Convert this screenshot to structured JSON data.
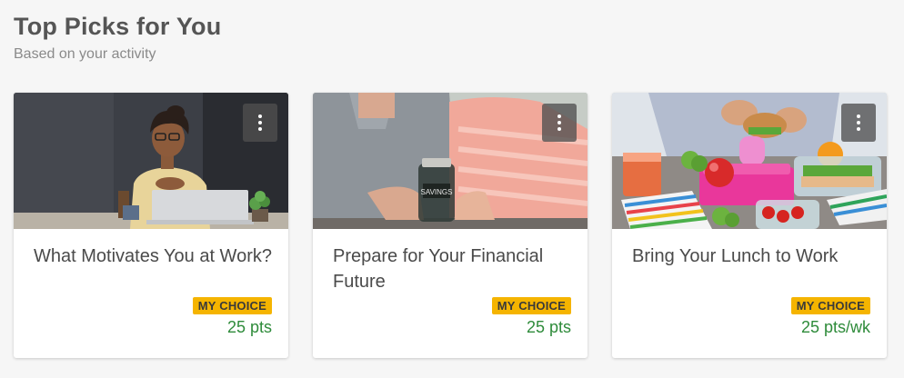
{
  "header": {
    "title": "Top Picks for You",
    "subtitle": "Based on your activity"
  },
  "cards": [
    {
      "title": "What Motivates You at Work?",
      "badge": "MY CHOICE",
      "points": "25 pts",
      "image": "woman-at-laptop",
      "jar_label": ""
    },
    {
      "title": "Prepare for Your Financial Future",
      "badge": "MY CHOICE",
      "points": "25 pts",
      "image": "couple-savings-jar",
      "jar_label": "SAVINGS"
    },
    {
      "title": "Bring Your Lunch to Work",
      "badge": "MY CHOICE",
      "points": "25 pts/wk",
      "image": "packed-lunch",
      "jar_label": ""
    }
  ],
  "colors": {
    "background": "#f6f6f6",
    "badge": "#f5b400",
    "points": "#2e8b3a",
    "title": "#555555"
  }
}
